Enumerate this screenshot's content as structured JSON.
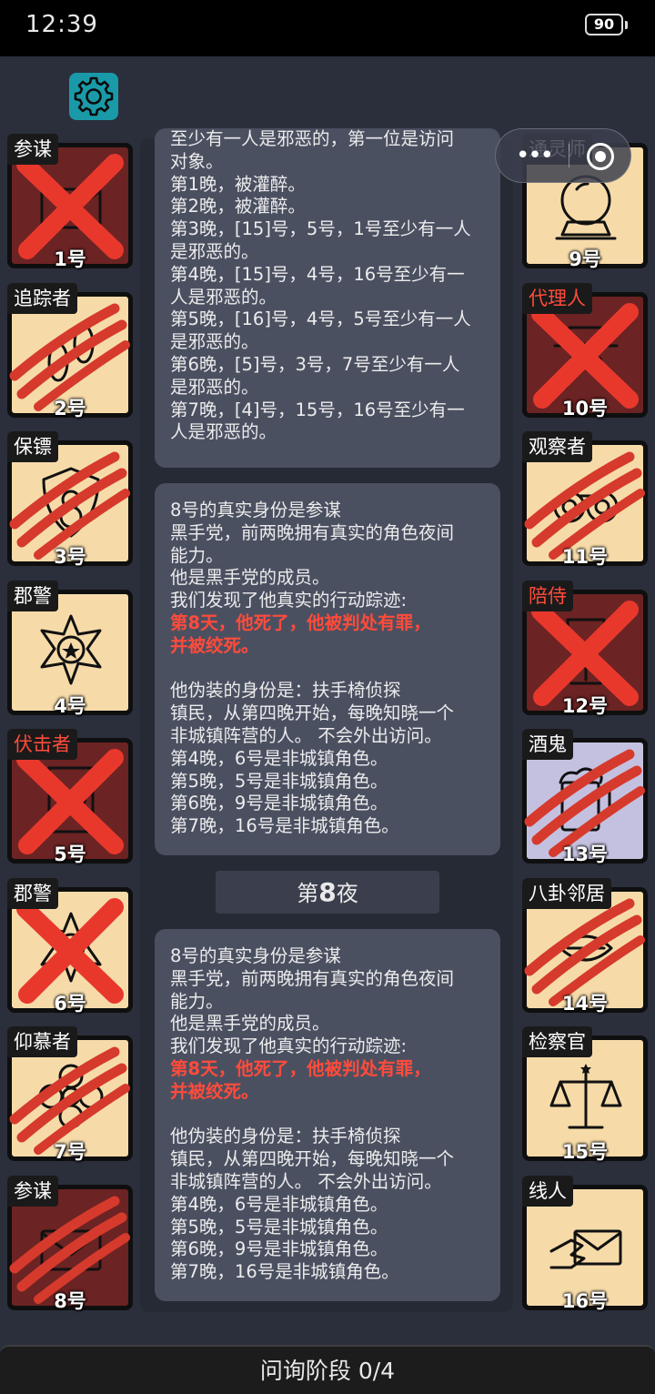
{
  "status_bar": {
    "time": "12:39",
    "battery": "90"
  },
  "top_left_icon": "gear-icon",
  "capsule": {
    "more_icon": "more-dots-icon",
    "close_icon": "record-circle-icon"
  },
  "colors": {
    "background": "#2b2f3c",
    "card": "#4b5061",
    "alert_red": "#ff4b3b",
    "tile": "#f6dba9",
    "dead_tile": "#6c2323"
  },
  "left_seats": [
    {
      "role": "参谋",
      "number": "1号",
      "role_color": "white",
      "state": "dead",
      "icon": "envelope-icon",
      "mark": "x"
    },
    {
      "role": "追踪者",
      "number": "2号",
      "role_color": "white",
      "state": "alive",
      "icon": "footprints-icon",
      "mark": "claw"
    },
    {
      "role": "保镖",
      "number": "3号",
      "role_color": "white",
      "state": "alive",
      "icon": "shield-icon",
      "mark": "claw"
    },
    {
      "role": "郡警",
      "number": "4号",
      "role_color": "white",
      "state": "alive",
      "icon": "sheriff-star-icon",
      "mark": "none"
    },
    {
      "role": "伏击者",
      "number": "5号",
      "role_color": "red",
      "state": "dead",
      "icon": "door-icon",
      "mark": "x"
    },
    {
      "role": "郡警",
      "number": "6号",
      "role_color": "white",
      "state": "alive",
      "icon": "sheriff-star-icon",
      "mark": "x"
    },
    {
      "role": "仰慕者",
      "number": "7号",
      "role_color": "white",
      "state": "alive",
      "icon": "flower-icon",
      "mark": "claw"
    },
    {
      "role": "参谋",
      "number": "8号",
      "role_color": "white",
      "state": "dead",
      "icon": "envelope-icon",
      "mark": "claw"
    }
  ],
  "right_seats": [
    {
      "role": "通灵师",
      "number": "9号",
      "role_color": "white",
      "state": "alive",
      "icon": "crystal-ball-icon",
      "mark": "none"
    },
    {
      "role": "代理人",
      "number": "10号",
      "role_color": "red",
      "state": "dead",
      "icon": "agent-hat-icon",
      "mark": "x"
    },
    {
      "role": "观察者",
      "number": "11号",
      "role_color": "white",
      "state": "alive",
      "icon": "binoculars-icon",
      "mark": "claw"
    },
    {
      "role": "陪侍",
      "number": "12号",
      "role_color": "red",
      "state": "dead",
      "icon": "wine-glass-icon",
      "mark": "x"
    },
    {
      "role": "酒鬼",
      "number": "13号",
      "role_color": "white",
      "state": "drunk",
      "icon": "beer-mug-icon",
      "mark": "claw"
    },
    {
      "role": "八卦邻居",
      "number": "14号",
      "role_color": "white",
      "state": "alive",
      "icon": "mouth-icon",
      "mark": "claw"
    },
    {
      "role": "检察官",
      "number": "15号",
      "role_color": "white",
      "state": "alive",
      "icon": "scales-icon",
      "mark": "none"
    },
    {
      "role": "线人",
      "number": "16号",
      "role_color": "white",
      "state": "alive",
      "icon": "hand-letter-icon",
      "mark": "none"
    }
  ],
  "cards": [
    {
      "lines": [
        {
          "t": "至少有一人是邪恶的，第一位是访问"
        },
        {
          "t": "对象。"
        },
        {
          "t": "第1晚，被灌醉。"
        },
        {
          "t": "第2晚，被灌醉。"
        },
        {
          "t": "第3晚，[15]号，5号，1号至少有一人"
        },
        {
          "t": "是邪恶的。"
        },
        {
          "t": "第4晚，[15]号，4号，16号至少有一"
        },
        {
          "t": "人是邪恶的。"
        },
        {
          "t": "第5晚，[16]号，4号，5号至少有一人"
        },
        {
          "t": "是邪恶的。"
        },
        {
          "t": "第6晚，[5]号，3号，7号至少有一人"
        },
        {
          "t": "是邪恶的。"
        },
        {
          "t": "第7晚，[4]号，15号，16号至少有一"
        },
        {
          "t": "人是邪恶的。"
        }
      ]
    },
    {
      "lines": [
        {
          "t": "8号的真实身份是参谋"
        },
        {
          "t": "黑手党，前两晚拥有真实的角色夜间"
        },
        {
          "t": "能力。"
        },
        {
          "t": "他是黑手党的成员。"
        },
        {
          "t": "我们发现了他真实的行动踪迹:"
        },
        {
          "t": "第8天，他死了，他被判处有罪，",
          "red": true
        },
        {
          "t": "并被绞死。",
          "red": true
        },
        {
          "t": ""
        },
        {
          "t": "他伪装的身份是：扶手椅侦探"
        },
        {
          "t": "镇民，从第四晚开始，每晚知晓一个"
        },
        {
          "t": "非城镇阵营的人。 不会外出访问。"
        },
        {
          "t": "第4晚，6号是非城镇角色。"
        },
        {
          "t": "第5晚，5号是非城镇角色。"
        },
        {
          "t": "第6晚，9号是非城镇角色。"
        },
        {
          "t": "第7晚，16号是非城镇角色。"
        }
      ]
    },
    {
      "lines": [
        {
          "t": "8号的真实身份是参谋"
        },
        {
          "t": "黑手党，前两晚拥有真实的角色夜间"
        },
        {
          "t": "能力。"
        },
        {
          "t": "他是黑手党的成员。"
        },
        {
          "t": "我们发现了他真实的行动踪迹:"
        },
        {
          "t": "第8天，他死了，他被判处有罪，",
          "red": true
        },
        {
          "t": "并被绞死。",
          "red": true
        },
        {
          "t": ""
        },
        {
          "t": "他伪装的身份是：扶手椅侦探"
        },
        {
          "t": "镇民，从第四晚开始，每晚知晓一个"
        },
        {
          "t": "非城镇阵营的人。 不会外出访问。"
        },
        {
          "t": "第4晚，6号是非城镇角色。"
        },
        {
          "t": "第5晚，5号是非城镇角色。"
        },
        {
          "t": "第6晚，9号是非城镇角色。"
        },
        {
          "t": "第7晚，16号是非城镇角色。"
        }
      ]
    }
  ],
  "night_divider": {
    "prefix": "第",
    "number": "8",
    "suffix": "夜"
  },
  "bottom_bar": {
    "label": "问询阶段 0/4"
  }
}
